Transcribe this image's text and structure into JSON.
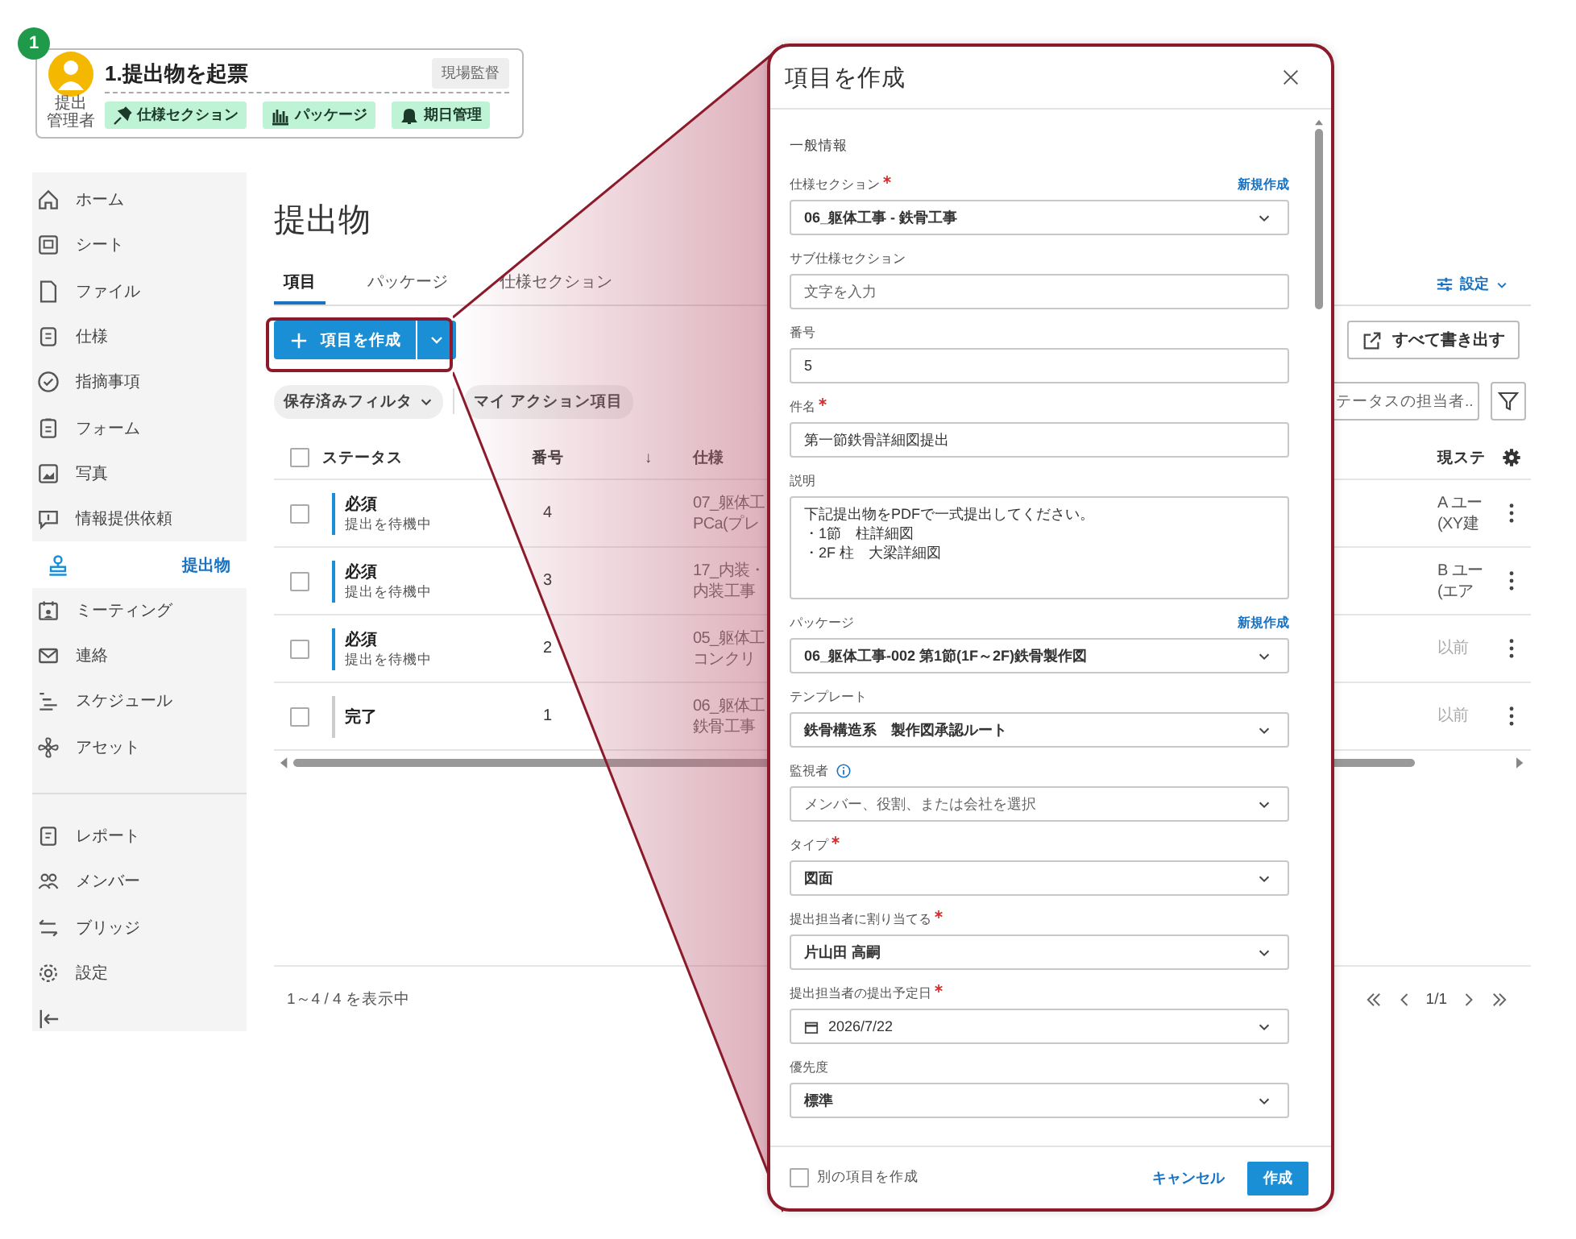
{
  "callout": {
    "step": "1",
    "title": "1.提出物を起票",
    "role": "現場監督",
    "actor": [
      "提出",
      "管理者"
    ],
    "chips": [
      {
        "label": "仕様セクション"
      },
      {
        "label": "パッケージ"
      },
      {
        "label": "期日管理"
      }
    ]
  },
  "sidebar": {
    "items": [
      {
        "label": "ホーム",
        "selected": false
      },
      {
        "label": "シート",
        "selected": false
      },
      {
        "label": "ファイル",
        "selected": false
      },
      {
        "label": "仕様",
        "selected": false
      },
      {
        "label": "指摘事項",
        "selected": false
      },
      {
        "label": "フォーム",
        "selected": false
      },
      {
        "label": "写真",
        "selected": false
      },
      {
        "label": "情報提供依頼",
        "selected": false
      },
      {
        "label": "提出物",
        "selected": true
      },
      {
        "label": "ミーティング",
        "selected": false
      },
      {
        "label": "連絡",
        "selected": false
      },
      {
        "label": "スケジュール",
        "selected": false
      },
      {
        "label": "アセット",
        "selected": false
      }
    ],
    "bottom_items": [
      {
        "label": "レポート",
        "selected": false
      },
      {
        "label": "メンバー",
        "selected": false
      },
      {
        "label": "ブリッジ",
        "selected": false
      },
      {
        "label": "設定",
        "selected": false
      }
    ]
  },
  "page": {
    "title": "提出物"
  },
  "tabs": [
    {
      "label": "項目",
      "selected": true
    },
    {
      "label": "パッケージ",
      "selected": false
    },
    {
      "label": "仕様セクション",
      "selected": false
    }
  ],
  "settings_link": "設定",
  "create_button": "項目を作成",
  "export_button": "すべて書き出す",
  "filters": [
    {
      "label": "保存済みフィルタ",
      "kind": "dropdown"
    },
    {
      "label": "マイ アクション項目",
      "kind": "toggle"
    }
  ],
  "search": {
    "placeholder": "テータスの担当者..."
  },
  "table": {
    "select_all": {
      "checked": false
    },
    "columns": {
      "status": "ステータス",
      "number": "番号",
      "sort": "↓",
      "spec": "仕様",
      "current": "現ステ"
    },
    "rows": [
      {
        "checked": false,
        "status": "必須",
        "substatus": "提出を待機中",
        "color": "#1a8fd6",
        "number": "4",
        "spec": [
          "07_躯体工",
          "PCa(プレ"
        ],
        "current": [
          "A ユー",
          "(XY建"
        ],
        "muted": false
      },
      {
        "checked": false,
        "status": "必須",
        "substatus": "提出を待機中",
        "color": "#1a8fd6",
        "number": "3",
        "spec": [
          "17_内装・",
          "内装工事"
        ],
        "current": [
          "B ユー",
          "(エア"
        ],
        "muted": false
      },
      {
        "checked": false,
        "status": "必須",
        "substatus": "提出を待機中",
        "color": "#1a8fd6",
        "number": "2",
        "spec": [
          "05_躯体工",
          "コンクリ"
        ],
        "current": [
          "以前"
        ],
        "muted": true
      },
      {
        "checked": false,
        "status": "完了",
        "color": "#cccccc",
        "number": "1",
        "spec": [
          "06_躯体工",
          "鉄骨工事"
        ],
        "current": [
          "以前"
        ],
        "muted": true
      }
    ]
  },
  "footer": {
    "summary": "1～4 / 4 を表示中",
    "page": "1/1"
  },
  "dialog": {
    "title": "項目を作成",
    "section": "一般情報",
    "fields": [
      {
        "kind": "select",
        "label": "仕様セクション",
        "required": true,
        "link": "新規作成",
        "value": "06_躯体工事 - 鉄骨工事"
      },
      {
        "kind": "input",
        "label": "サブ仕様セクション",
        "required": false,
        "placeholder": "文字を入力"
      },
      {
        "kind": "input",
        "label": "番号",
        "required": false,
        "value": "5"
      },
      {
        "kind": "input",
        "label": "件名",
        "required": true,
        "value": "第一節鉄骨詳細図提出"
      },
      {
        "kind": "textarea",
        "label": "説明",
        "required": false,
        "lines": [
          "下記提出物をPDFで一式提出してください。",
          "・1節　柱詳細図",
          "・2F 柱　大梁詳細図"
        ]
      },
      {
        "kind": "select",
        "label": "パッケージ",
        "required": false,
        "link": "新規作成",
        "value": "06_躯体工事-002 第1節(1F～2F)鉄骨製作図"
      },
      {
        "kind": "select",
        "label": "テンプレート",
        "required": false,
        "value": "鉄骨構造系　製作図承認ルート"
      },
      {
        "kind": "select",
        "label": "監視者",
        "required": false,
        "info": true,
        "placeholder": "メンバー、役割、または会社を選択"
      },
      {
        "kind": "select",
        "label": "タイプ",
        "required": true,
        "value": "図面"
      },
      {
        "kind": "select",
        "label": "提出担当者に割り当てる",
        "required": true,
        "value": "片山田 高嗣"
      },
      {
        "kind": "date",
        "label": "提出担当者の提出予定日",
        "required": true,
        "value": "2026/7/22"
      },
      {
        "kind": "select",
        "label": "優先度",
        "required": false,
        "value": "標準"
      }
    ],
    "footer": {
      "checkbox_label": "別の項目を作成",
      "checked": false,
      "cancel": "キャンセル",
      "submit": "作成"
    }
  }
}
